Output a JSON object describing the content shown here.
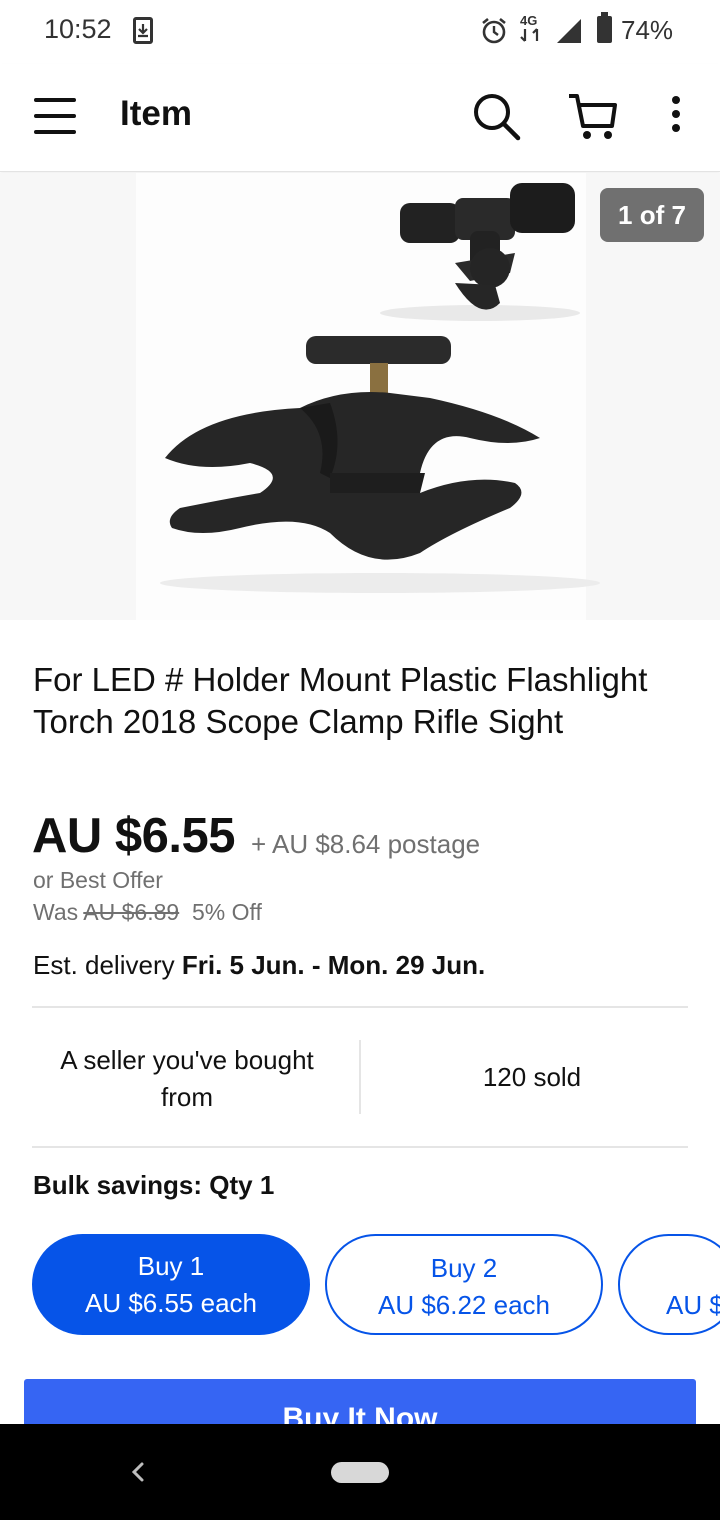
{
  "status_bar": {
    "time": "10:52",
    "network": "4G",
    "battery": "74%",
    "icons": [
      "download-icon",
      "alarm-icon",
      "network-4g-icon",
      "signal-icon",
      "battery-icon"
    ]
  },
  "app_bar": {
    "title": "Item",
    "icons": [
      "menu-icon",
      "search-icon",
      "cart-icon",
      "more-icon"
    ]
  },
  "gallery": {
    "counter": "1 of 7",
    "current": 1,
    "total": 7
  },
  "item": {
    "title": "For LED # Holder Mount Plastic Flashlight Torch 2018 Scope Clamp Rifle Sight",
    "price": "AU $6.55",
    "postage": "+ AU $8.64 postage",
    "best_offer": "or Best Offer",
    "was_label": "Was",
    "was_price": "AU $6.89",
    "discount": "5% Off",
    "delivery_label": "Est. delivery",
    "delivery_dates": "Fri. 5 Jun. - Mon. 29 Jun."
  },
  "seller": {
    "note": "A seller you've bought from",
    "sold": "120 sold"
  },
  "bulk": {
    "label": "Bulk savings: Qty 1",
    "options": [
      {
        "qty": "Buy 1",
        "price": "AU $6.55 each",
        "selected": true
      },
      {
        "qty": "Buy 2",
        "price": "AU $6.22 each",
        "selected": false
      },
      {
        "qty": "",
        "price": "AU $",
        "selected": false
      }
    ]
  },
  "actions": {
    "buy_now": "Buy It Now"
  },
  "colors": {
    "accent": "#0654e8",
    "buy_now_bg": "#3665f3",
    "muted_text": "#707070",
    "counter_bg": "#707070",
    "nav_bar_bg": "#000000"
  }
}
